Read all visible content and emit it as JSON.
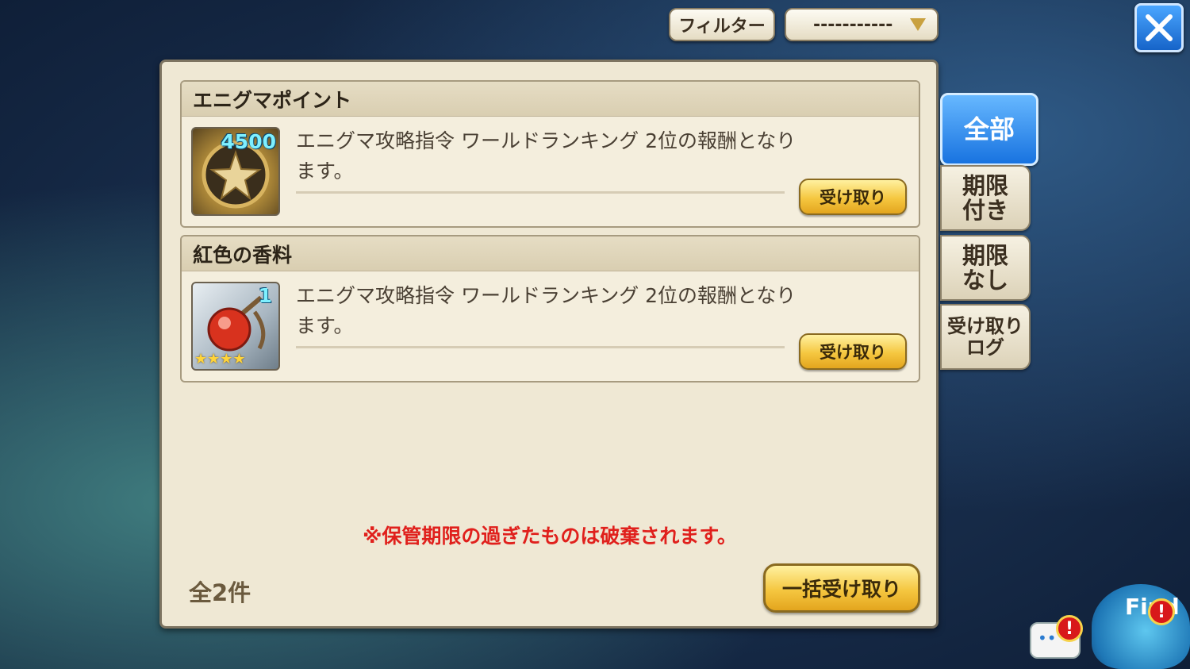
{
  "topbar": {
    "filter_label": "フィルター",
    "select_value": "-----------"
  },
  "items": [
    {
      "title": "エニグマポイント",
      "quantity": "4500",
      "description": "エニグマ攻略指令 ワールドランキング 2位の報酬となります。",
      "button_label": "受け取り",
      "icon": "enigma-point-medal-icon"
    },
    {
      "title": "紅色の香料",
      "quantity": "1",
      "stars": 4,
      "description": "エニグマ攻略指令 ワールドランキング 2位の報酬となります。",
      "button_label": "受け取り",
      "icon": "red-perfume-bottle-icon"
    }
  ],
  "notice": "※保管期限の過ぎたものは破棄されます。",
  "count_label": "全2件",
  "bulk_button_label": "一括受け取り",
  "side_tabs": [
    {
      "label": "全部",
      "active": true
    },
    {
      "label": "期限\n付き",
      "active": false
    },
    {
      "label": "期限\nなし",
      "active": false
    },
    {
      "label": "受け取り\nログ",
      "active": false
    }
  ],
  "corner": {
    "mascot_text": "Find",
    "alert_mark": "!"
  },
  "colors": {
    "notice_red": "#e0201c",
    "active_tab_blue": "#1873e0",
    "button_gold": "#f5c740",
    "panel_bg": "#efe8d4"
  }
}
